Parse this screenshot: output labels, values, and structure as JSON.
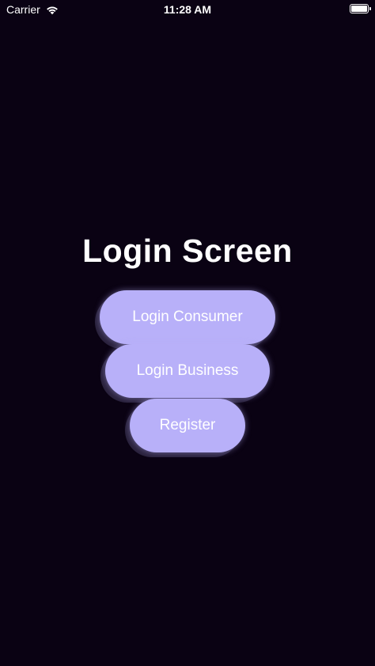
{
  "status_bar": {
    "carrier": "Carrier",
    "time": "11:28 AM",
    "wifi_icon": "wifi-icon",
    "battery_icon": "battery-icon"
  },
  "screen": {
    "title": "Login Screen"
  },
  "buttons": {
    "login_consumer": "Login Consumer",
    "login_business": "Login Business",
    "register": "Register"
  },
  "colors": {
    "background": "#0a0213",
    "button": "#b8b0f9",
    "text": "#ffffff"
  }
}
